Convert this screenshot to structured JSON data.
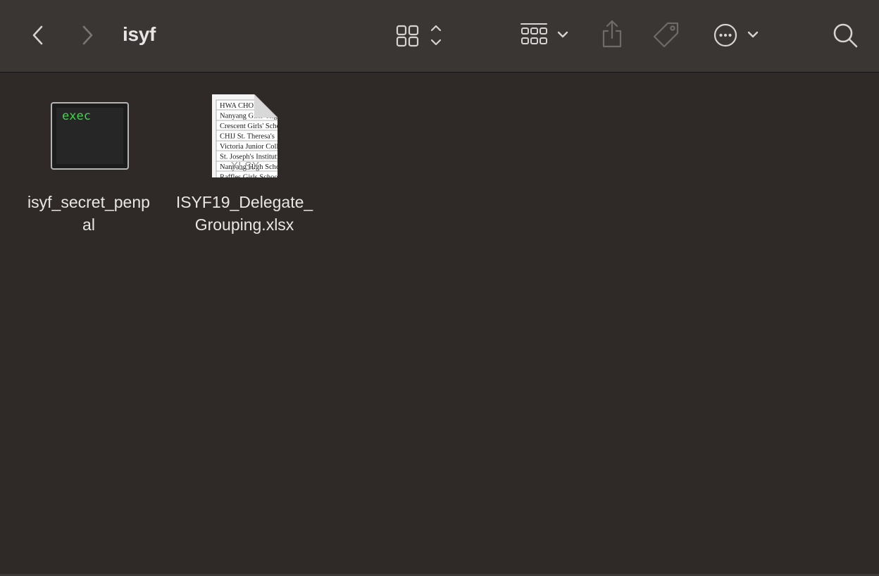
{
  "window": {
    "title": "isyf"
  },
  "toolbar": {
    "back_icon": "chevron-left-icon",
    "forward_icon": "chevron-right-icon",
    "view_icon": "grid-view-icon",
    "group_icon": "group-by-icon",
    "share_icon": "share-icon",
    "tag_icon": "tag-icon",
    "more_icon": "ellipsis-circle-icon",
    "search_icon": "search-icon"
  },
  "files": [
    {
      "name": "isyf_secret_penp\nal",
      "icon": "exec-terminal-icon",
      "icon_text": "exec",
      "icon_text_color": "#42d64a"
    },
    {
      "name": "ISYF19_Delegate_\nGrouping.xlsx",
      "icon": "xlsx-document-icon",
      "icon_tag": "XLSX",
      "preview_rows": [
        "HWA CHONG",
        "Nanyang Girls' High",
        "Crescent Girls' School",
        "CHIJ St. Theresa's",
        "Victoria Junior College",
        "St. Joseph's Institution",
        "Nanyang High School",
        "Raffles Girls School"
      ]
    }
  ],
  "colors": {
    "toolbar_bg": "#3a3634",
    "content_bg": "#2f2a28",
    "text": "#e9e7e5",
    "icon": "#d9d7d5",
    "icon_dim": "#7a7674"
  }
}
